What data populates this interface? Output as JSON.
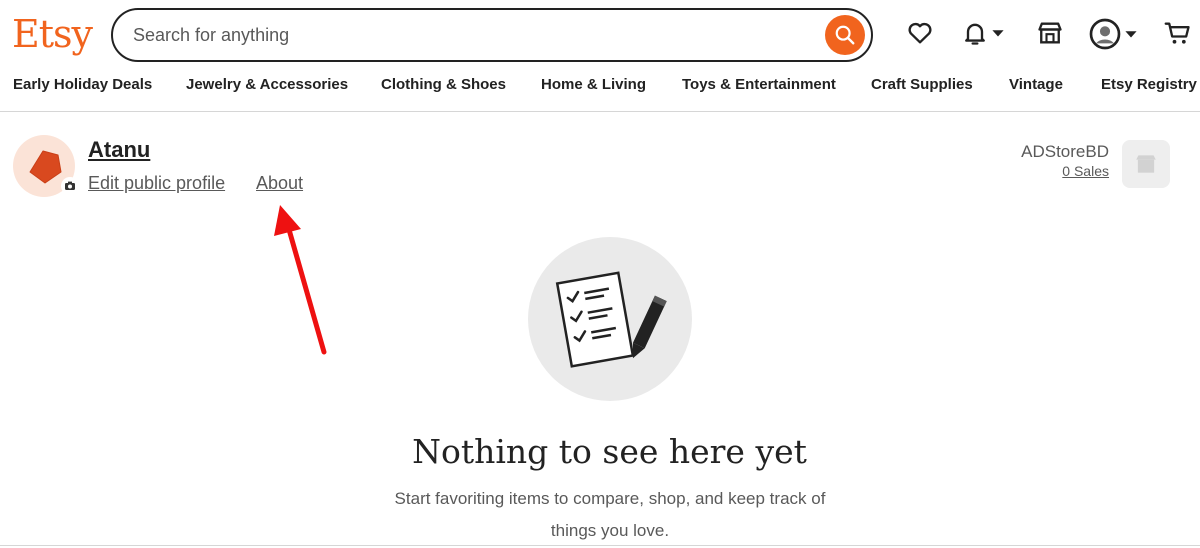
{
  "header": {
    "logo": "Etsy",
    "search_placeholder": "Search for anything",
    "icons": [
      "favorites-heart-icon",
      "notifications-bell-icon",
      "shop-manager-icon",
      "account-avatar-icon",
      "cart-icon"
    ]
  },
  "categories": [
    "Early Holiday Deals",
    "Jewelry & Accessories",
    "Clothing & Shoes",
    "Home & Living",
    "Toys & Entertainment",
    "Craft Supplies",
    "Vintage",
    "Etsy Registry"
  ],
  "profile": {
    "name": "Atanu",
    "edit_link": "Edit public profile",
    "about_link": "About"
  },
  "shop": {
    "name": "ADStoreBD",
    "sales": "0 Sales"
  },
  "empty_state": {
    "title": "Nothing to see here yet",
    "subtitle": "Start favoriting items to compare, shop, and keep track of things you love."
  },
  "colors": {
    "brand": "#f1641e",
    "annotation_arrow": "#ee1111"
  }
}
